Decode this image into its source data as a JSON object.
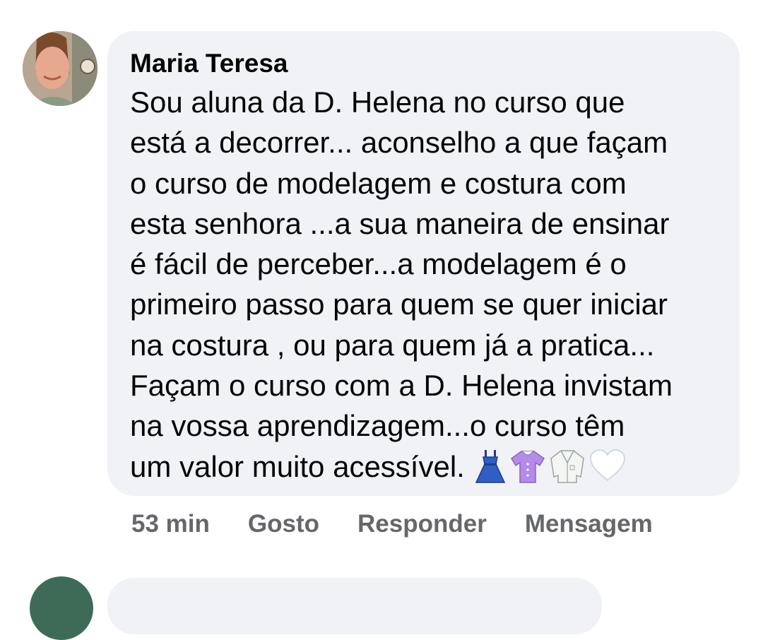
{
  "comment": {
    "author": "Maria Teresa",
    "lines": [
      "Sou aluna da D. Helena no curso que",
      "está a decorrer... aconselho a que façam",
      "o curso de modelagem e costura com",
      "esta senhora ...a sua maneira de ensinar",
      "é fácil de perceber...a modelagem é o",
      "primeiro passo para quem se quer iniciar",
      "na costura , ou para quem já a pratica...",
      "Façam o curso com a D. Helena invistam",
      "na vossa aprendizagem...o curso têm",
      "um valor muito acessível."
    ],
    "emojis": [
      "dress-icon",
      "shirt-icon",
      "lab-coat-icon",
      "white-heart-icon"
    ]
  },
  "actions": {
    "time": "53 min",
    "like": "Gosto",
    "reply": "Responder",
    "message": "Mensagem"
  },
  "colors": {
    "bubble": "#f0f2f5",
    "text": "#050505",
    "muted": "#65676b"
  }
}
